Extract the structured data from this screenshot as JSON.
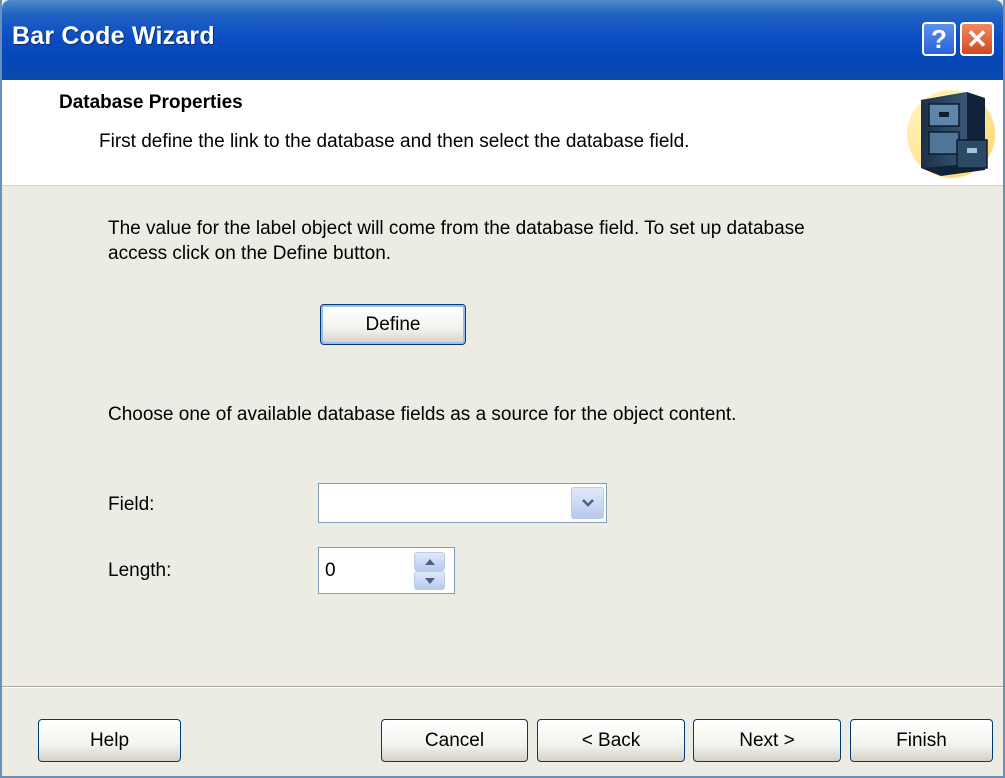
{
  "window": {
    "title": "Bar Code Wizard",
    "help_label": "?",
    "close_label": "✕"
  },
  "header": {
    "title": "Database Properties",
    "subtitle": "First define the link to the database and then select the database field.",
    "icon": "database-cabinet-icon"
  },
  "content": {
    "intro_line1": "The value for the label object will come from the database field. To set up database",
    "intro_line2": "access click on the Define button.",
    "define_label": "Define",
    "choose_text": "Choose one of available database fields as a source for the object content.",
    "field_label": "Field:",
    "field_value": "",
    "length_label": "Length:",
    "length_value": "0"
  },
  "footer": {
    "help_label": "Help",
    "cancel_label": "Cancel",
    "back_label": "< Back",
    "next_label": "Next >",
    "finish_label": "Finish"
  },
  "colors": {
    "titlebar": "#0a4fc4",
    "dialog_bg": "#ecebe4",
    "button_border": "#003c74",
    "close_button": "#d2491d"
  }
}
